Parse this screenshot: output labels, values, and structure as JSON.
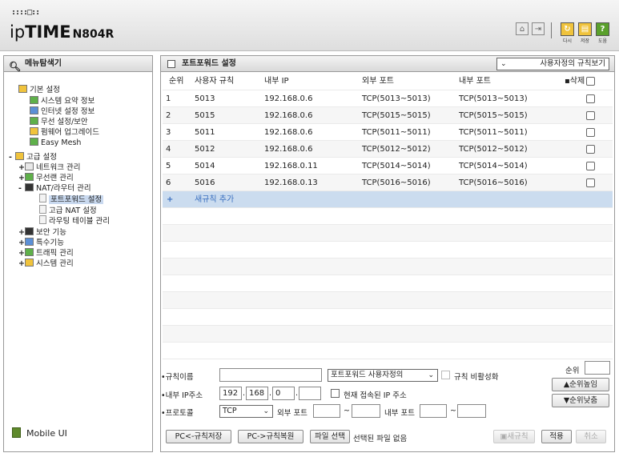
{
  "header": {
    "brand_prefix": "ip",
    "brand_bold": "TIME",
    "model": "N804R",
    "dots": "::::□::",
    "icons": [
      "home-icon",
      "logout-icon"
    ],
    "actions": [
      {
        "name": "reload-icon",
        "label": "다시",
        "color": "#f0c33c",
        "glyph": "↻"
      },
      {
        "name": "save-icon",
        "label": "저장",
        "color": "#f0c33c",
        "glyph": "▤"
      },
      {
        "name": "help-icon",
        "label": "도움",
        "color": "#5aa02c",
        "glyph": "?"
      }
    ]
  },
  "left": {
    "title": "메뉴탐색기",
    "mobile_label": "Mobile UI",
    "tree": {
      "basic": "기본 설정",
      "basic_items": [
        "시스템 요약 정보",
        "인터넷 설정 정보",
        "무선 설정/보안",
        "펌웨어 업그레이드",
        "Easy Mesh"
      ],
      "advanced": "고급 설정",
      "network": "네트워크 관리",
      "wlan": "무선랜 관리",
      "nat": "NAT/라우터 관리",
      "nat_items": [
        "포트포워드 설정",
        "고급 NAT 설정",
        "라우팅 테이블 관리"
      ],
      "others": [
        "보안 기능",
        "특수기능",
        "트래픽 관리",
        "시스템 관리"
      ]
    }
  },
  "main": {
    "title": "포트포워드 설정",
    "view_select": "사용자정의 규칙보기",
    "columns": {
      "order": "순위",
      "name": "사용자 규칙",
      "inner_ip": "내부 IP",
      "ext_port": "외부 포트",
      "inner_port": "내부 포트",
      "delete": "삭제"
    },
    "rows": [
      {
        "order": "1",
        "name": "5013",
        "ip": "192.168.0.6",
        "ext": "TCP(5013~5013)",
        "inner": "TCP(5013~5013)"
      },
      {
        "order": "2",
        "name": "5015",
        "ip": "192.168.0.6",
        "ext": "TCP(5015~5015)",
        "inner": "TCP(5015~5015)"
      },
      {
        "order": "3",
        "name": "5011",
        "ip": "192.168.0.6",
        "ext": "TCP(5011~5011)",
        "inner": "TCP(5011~5011)"
      },
      {
        "order": "4",
        "name": "5012",
        "ip": "192.168.0.6",
        "ext": "TCP(5012~5012)",
        "inner": "TCP(5012~5012)"
      },
      {
        "order": "5",
        "name": "5014",
        "ip": "192.168.0.11",
        "ext": "TCP(5014~5014)",
        "inner": "TCP(5014~5014)"
      },
      {
        "order": "6",
        "name": "5016",
        "ip": "192.168.0.13",
        "ext": "TCP(5016~5016)",
        "inner": "TCP(5016~5016)"
      }
    ],
    "add_plus": "+",
    "add_label": "새규칙 추가"
  },
  "form": {
    "rule_name_label": "규칙이름",
    "rule_type": "포트포워드 사용자정의",
    "disable_label": "규칙 비활성화",
    "inner_ip_label": "내부 IP주소",
    "ip": [
      "192",
      "168",
      "0",
      ""
    ],
    "current_ip_label": "현재 접속된 IP 주소",
    "protocol_label": "프로토콜",
    "protocol": "TCP",
    "ext_port_label": "외부 포트",
    "inner_port_label": "내부 포트",
    "tilde": "~",
    "order_label": "순위",
    "up_label": "▲순위높임",
    "down_label": "▼순위낮춤"
  },
  "buttons": {
    "backup": "PC<-규칙저장",
    "restore": "PC->규칙복원",
    "file_select": "파일 선택",
    "no_file": "선택된 파일 없음",
    "new_rule": "새규칙",
    "apply": "적용",
    "cancel": "취소"
  }
}
